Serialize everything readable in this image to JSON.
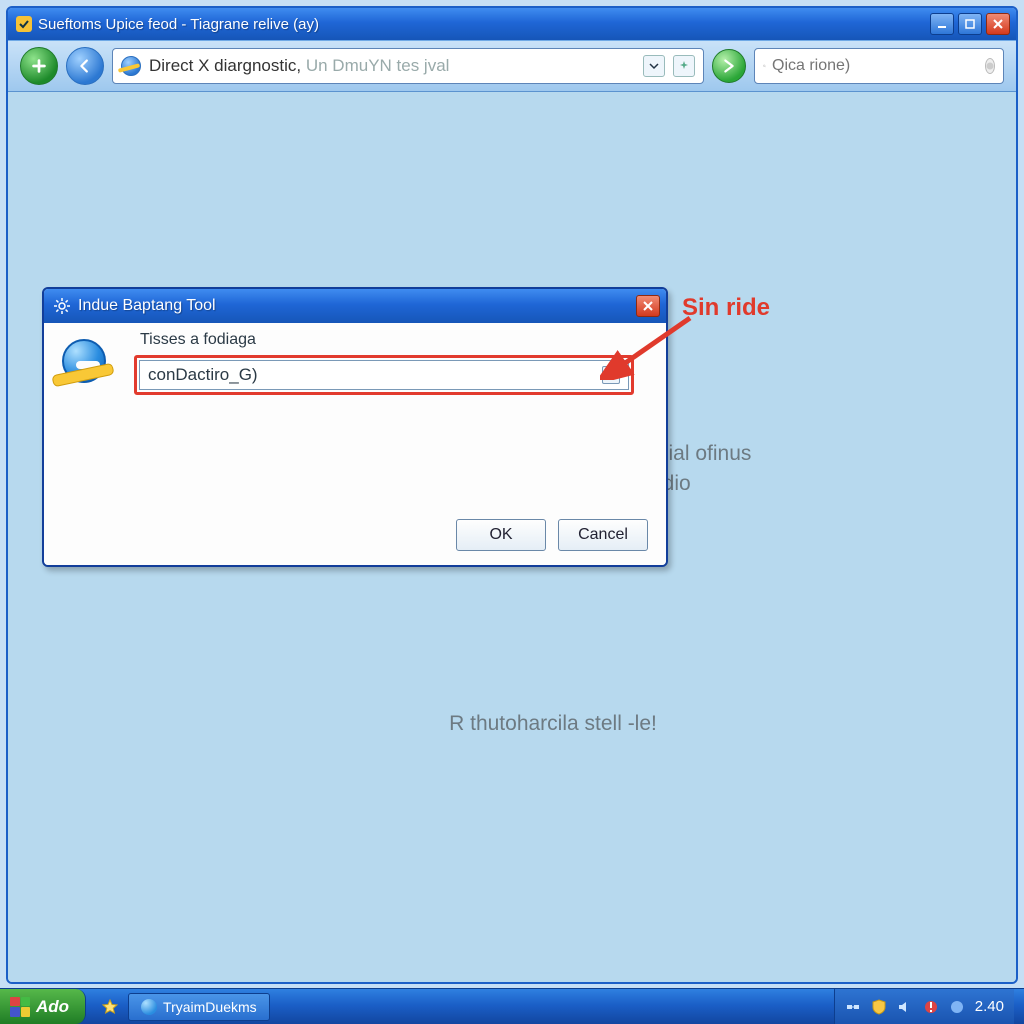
{
  "window": {
    "title": "Sueftoms Upice feod - Tiagrane relive (ay)",
    "address_main": "Direct X diargnostic, ",
    "address_gray": "Un DmuYN tes jval",
    "search_placeholder": "Qica rione)"
  },
  "dialog": {
    "title": "Indue Baptang Tool",
    "label": "Tisses a fodiaga",
    "combo_value": "conDactiro_G)",
    "ok": "OK",
    "cancel": "Cancel"
  },
  "annotation": {
    "text": "Sin ride"
  },
  "background_text": {
    "line1": "cial ofinus",
    "line2": "ldio",
    "footer": "R thutoharcila stell -le!"
  },
  "taskbar": {
    "start": "Ado",
    "task_item": "TryaimDuekms",
    "clock": "2.40"
  }
}
